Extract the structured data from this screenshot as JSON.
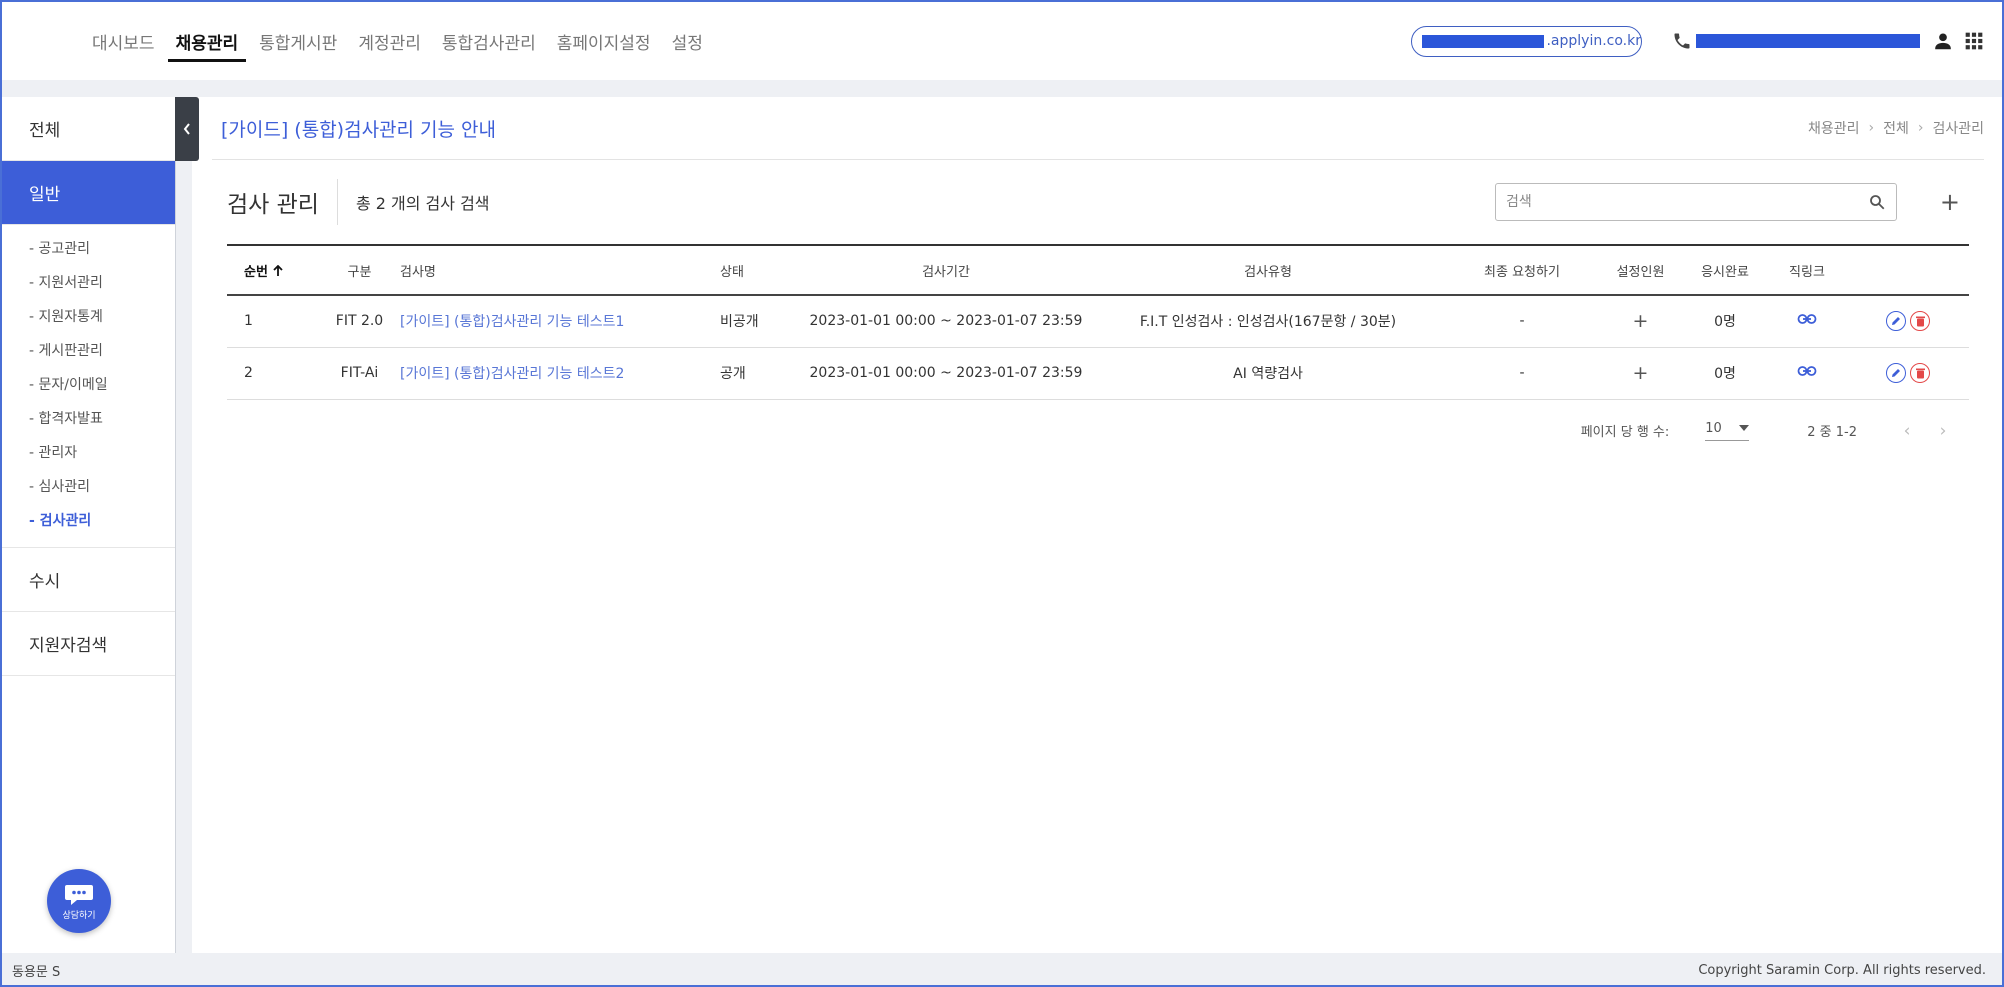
{
  "topnav": {
    "items": [
      {
        "label": "대시보드"
      },
      {
        "label": "채용관리"
      },
      {
        "label": "통합게시판"
      },
      {
        "label": "계정관리"
      },
      {
        "label": "통합검사관리"
      },
      {
        "label": "홈페이지설정"
      },
      {
        "label": "설정"
      }
    ],
    "active_index": 1,
    "email_suffix": ".applyin.co.kr"
  },
  "sidebar": {
    "cat_all": "전체",
    "cat_general": "일반",
    "sub_items": [
      {
        "label": "- 공고관리"
      },
      {
        "label": "- 지원서관리"
      },
      {
        "label": "- 지원자통계"
      },
      {
        "label": "- 게시판관리"
      },
      {
        "label": "- 문자/이메일"
      },
      {
        "label": "- 합격자발표"
      },
      {
        "label": "- 관리자"
      },
      {
        "label": "- 심사관리"
      },
      {
        "label": "- 검사관리"
      }
    ],
    "active_sub": 8,
    "cat_rolling": "수시",
    "cat_search": "지원자검색",
    "chat_label": "상담하기"
  },
  "page": {
    "title": "[가이드] (통합)검사관리 기능 안내",
    "breadcrumb": [
      "채용관리",
      "전체",
      "검사관리"
    ]
  },
  "section": {
    "title": "검사 관리",
    "count": "총 2 개의 검사 검색",
    "search_placeholder": "검색"
  },
  "table": {
    "headers": {
      "no": "순번",
      "type": "구분",
      "name": "검사명",
      "status": "상태",
      "period": "검사기간",
      "kind": "검사유형",
      "request": "최종 요청하기",
      "assigned": "설정인원",
      "done": "응시완료",
      "link": "직링크"
    },
    "rows": [
      {
        "no": "1",
        "type": "FIT 2.0",
        "name": "[가이트] (통합)검사관리 기능 테스트1",
        "status": "비공개",
        "period": "2023-01-01 00:00 ~ 2023-01-07 23:59",
        "kind": "F.I.T 인성검사 : 인성검사(167문항 / 30분)",
        "request": "-",
        "assigned": "+",
        "done": "0명"
      },
      {
        "no": "2",
        "type": "FIT-Ai",
        "name": "[가이트] (통합)검사관리 기능 테스트2",
        "status": "공개",
        "period": "2023-01-01 00:00 ~ 2023-01-07 23:59",
        "kind": "AI 역량검사",
        "request": "-",
        "assigned": "+",
        "done": "0명"
      }
    ]
  },
  "pager": {
    "per_page_label": "페이지 당 행 수:",
    "per_page_value": "10",
    "range": "2 중 1-2"
  },
  "footer": {
    "user": "동용문 S",
    "copyright": "Copyright Saramin Corp. All rights reserved."
  },
  "colors": {
    "accent": "#3d5ed8",
    "delete": "#e34848",
    "frame": "#4a6fd6"
  }
}
